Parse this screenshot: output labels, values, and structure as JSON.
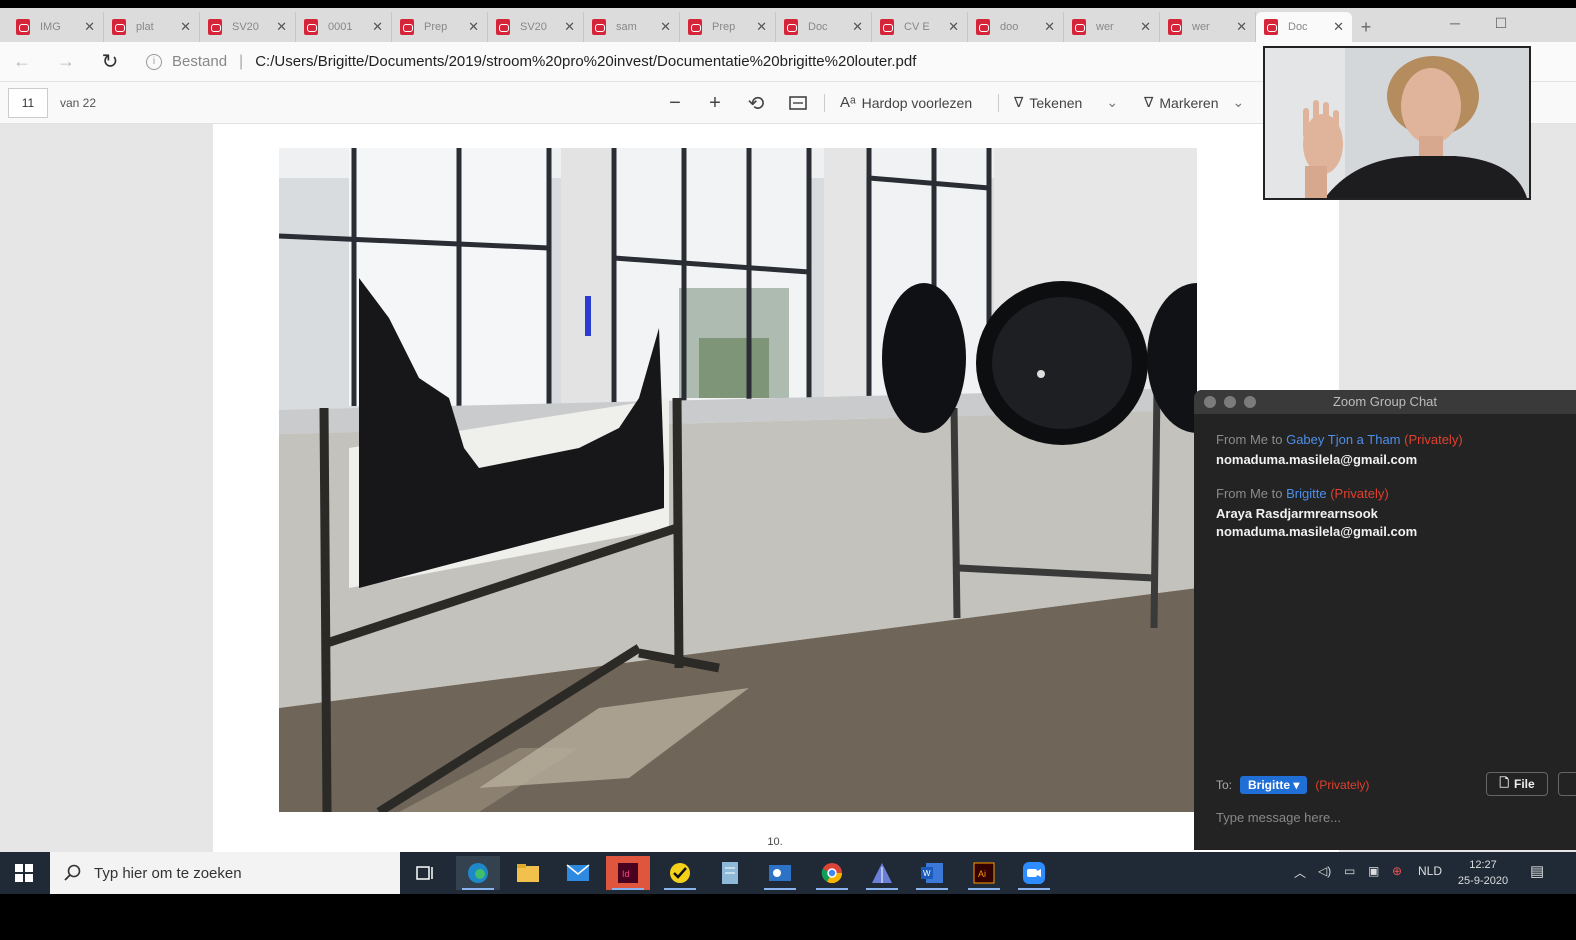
{
  "browser": {
    "tabs": [
      {
        "title": "IMG"
      },
      {
        "title": "plat"
      },
      {
        "title": "SV20"
      },
      {
        "title": "0001"
      },
      {
        "title": "Prep"
      },
      {
        "title": "SV20"
      },
      {
        "title": "sam"
      },
      {
        "title": "Prep"
      },
      {
        "title": "Doc"
      },
      {
        "title": "CV E"
      },
      {
        "title": "doo"
      },
      {
        "title": "wer"
      },
      {
        "title": "wer"
      },
      {
        "title": "Doc",
        "active": true
      }
    ],
    "new_tab_glyph": "+",
    "address": {
      "file_label": "Bestand",
      "url": "C:/Users/Brigitte/Documents/2019/stroom%20pro%20invest/Documentatie%20brigitte%20louter.pdf"
    }
  },
  "pdf_toolbar": {
    "page_current": "11",
    "page_total": "van 22",
    "read_aloud": "Hardop voorlezen",
    "draw": "Tekenen",
    "highlight": "Markeren"
  },
  "document": {
    "page_number": "10."
  },
  "zoom_chat": {
    "title": "Zoom Group Chat",
    "messages": [
      {
        "header_prefix": "From Me to",
        "recipient": "Gabey Tjon a Tham",
        "privately": "(Privately)",
        "lines": [
          "nomaduma.masilela@gmail.com"
        ]
      },
      {
        "header_prefix": "From Me to",
        "recipient": "Brigitte",
        "privately": "(Privately)",
        "lines": [
          "Araya Rasdjarmrearnsook",
          "nomaduma.masilela@gmail.com"
        ]
      }
    ],
    "to_label": "To:",
    "to_value": "Brigitte",
    "to_privately": "(Privately)",
    "file_button": "File",
    "input_placeholder": "Type message here..."
  },
  "taskbar": {
    "search_placeholder": "Typ hier om te zoeken",
    "language": "NLD",
    "time": "12:27",
    "date": "25-9-2020"
  },
  "colors": {
    "pdf_tab_icon": "#d6253b",
    "chat_bg": "#232323",
    "private_red": "#e0402f",
    "recipient_blue": "#4e8fe8",
    "to_select_blue": "#1f6fd6",
    "taskbar_bg": "#1f2a36"
  }
}
